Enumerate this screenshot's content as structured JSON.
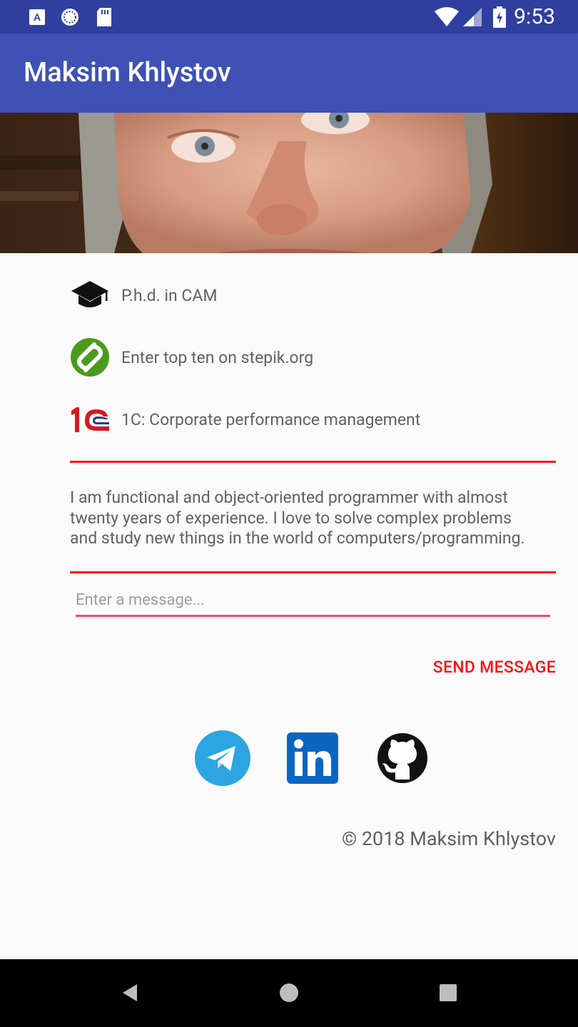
{
  "status_bar": {
    "time": "9:53",
    "icons": [
      "a-notification-icon",
      "sync-icon",
      "sd-card-icon",
      "wifi-icon",
      "cell-signal-icon",
      "battery-icon"
    ]
  },
  "app_bar": {
    "title": "Maksim Khlystov"
  },
  "profile_items": [
    {
      "icon": "graduation-cap-icon",
      "label": "P.h.d. in CAM"
    },
    {
      "icon": "stepik-logo-icon",
      "label": "Enter top ten on stepik.org"
    },
    {
      "icon": "1c-logo-icon",
      "label": "1C: Corporate performance management"
    }
  ],
  "about": {
    "line1": "I am functional and object-oriented programmer with almost",
    "line2": "twenty years of experience. I love to solve complex problems",
    "line3": "and study new things in the world of computers/programming."
  },
  "message": {
    "placeholder": "Enter a message...",
    "value": ""
  },
  "send_button": {
    "label": "SEND MESSAGE"
  },
  "social": [
    "telegram-icon",
    "linkedin-icon",
    "github-icon"
  ],
  "footer": {
    "copyright": "© 2018 Maksim Khlystov"
  },
  "colors": {
    "status_bar": "#303f9f",
    "app_bar": "#3f51b5",
    "divider": "#ff1010",
    "accent": "#ff4081",
    "send": "#ff1010"
  }
}
